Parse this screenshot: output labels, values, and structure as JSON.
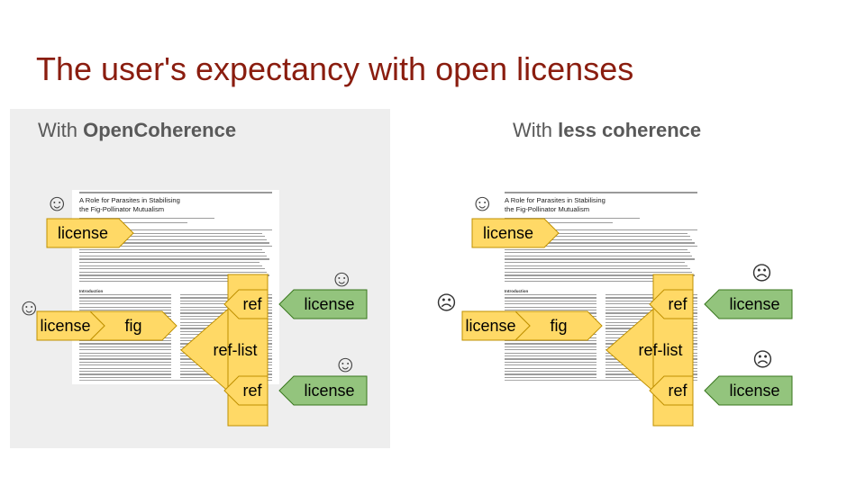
{
  "title": "The user's expectancy with open licenses",
  "left_panel": {
    "heading_prefix": "With ",
    "heading_bold": "OpenCoherence"
  },
  "right_panel": {
    "heading_prefix": "With ",
    "heading_bold": "less coherence"
  },
  "document": {
    "title_line1": "A Role for Parasites in Stabilising",
    "title_line2": "the Fig-Pollinator Mutualism",
    "section": "Introduction"
  },
  "labels": {
    "license": "license",
    "fig": "fig",
    "ref": "ref",
    "ref_list": "ref-list"
  },
  "icons": {
    "happy": "☺",
    "sad": "☹"
  },
  "colors": {
    "title": "#8a1d0f",
    "yellow": "#ffd966",
    "yellow_border": "#bf9000",
    "green": "#93c47d",
    "green_border": "#38761d",
    "panel": "#eeeeee"
  }
}
